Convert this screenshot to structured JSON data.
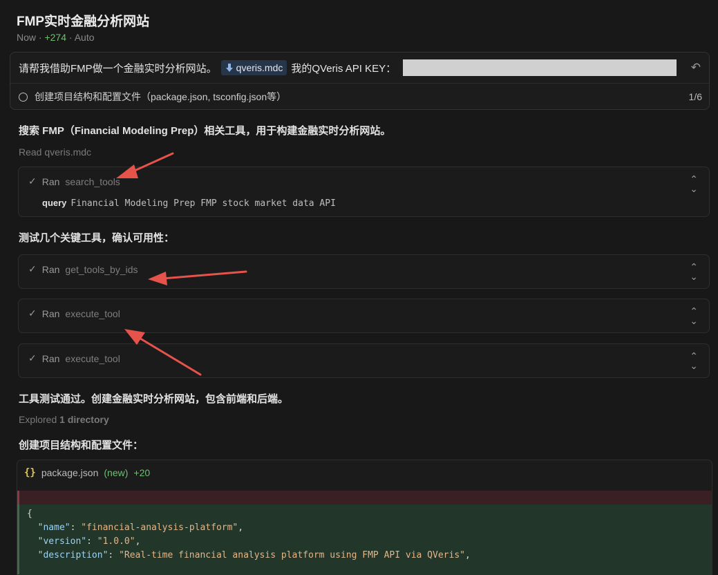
{
  "header": {
    "title": "FMP实时金融分析网站",
    "time": "Now",
    "dot1": "·",
    "additions": "+274",
    "dot2": "·",
    "mode": "Auto"
  },
  "prompt": {
    "text_before": "请帮我借助FMP做一个金融实时分析网站。",
    "chip_label": "qveris.mdc",
    "text_after": "我的QVeris API KEY：",
    "todo_label": "创建项目结构和配置文件（package.json, tsconfig.json等）",
    "todo_counter": "1/6"
  },
  "messages": {
    "search_intro": "搜索 FMP（Financial Modeling Prep）相关工具，用于构建金融实时分析网站。",
    "read_label": "Read",
    "read_file": "qveris.mdc",
    "test_intro": "测试几个关键工具，确认可用性：",
    "pass_msg": "工具测试通过。创建金融实时分析网站，包含前端和后端。",
    "explored_label": "Explored",
    "explored_count": "1 directory",
    "create_intro": "创建项目结构和配置文件："
  },
  "tools": [
    {
      "ran": "Ran",
      "name": "search_tools",
      "query_key": "query",
      "query_value": "Financial Modeling Prep FMP stock market data API"
    },
    {
      "ran": "Ran",
      "name": "get_tools_by_ids"
    },
    {
      "ran": "Ran",
      "name": "execute_tool"
    },
    {
      "ran": "Ran",
      "name": "execute_tool"
    }
  ],
  "codefile": {
    "icon": "{}",
    "filename": "package.json",
    "status": "(new)",
    "diff": "+20",
    "lines": [
      {
        "open": "{"
      },
      {
        "key": "\"name\"",
        "value": "\"financial-analysis-platform\""
      },
      {
        "key": "\"version\"",
        "value": "\"1.0.0\""
      },
      {
        "key": "\"description\"",
        "value": "\"Real-time financial analysis platform using FMP API via QVeris\""
      }
    ]
  },
  "colors": {
    "background": "#181818",
    "accent_green": "#6fbf73",
    "arrow_red": "#e5534b"
  }
}
